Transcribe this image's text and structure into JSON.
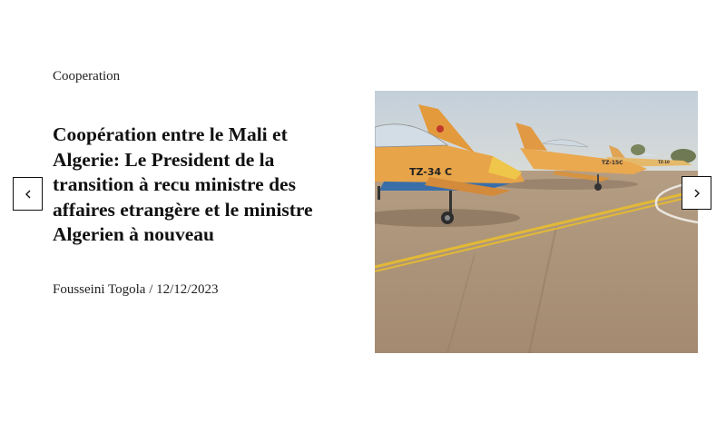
{
  "slide": {
    "category": "Cooperation",
    "title": "Coopération entre le Mali et Algerie: Le President de la transition à recu ministre des affaires etrangère et le ministre Algerien à nouveau",
    "author": "Fousseini Togola",
    "separator": "/",
    "date": "12/12/2023"
  },
  "image": {
    "aircraft_markings": [
      "TZ-34 C",
      "TZ-15C",
      "TZ-10"
    ]
  },
  "controls": {
    "prev_icon": "chevron-left-icon",
    "next_icon": "chevron-right-icon"
  },
  "colors": {
    "text": "#111111",
    "aircraft_yellow": "#e9a94a",
    "tarmac": "#a89176",
    "sky": "#c8d2dc"
  }
}
